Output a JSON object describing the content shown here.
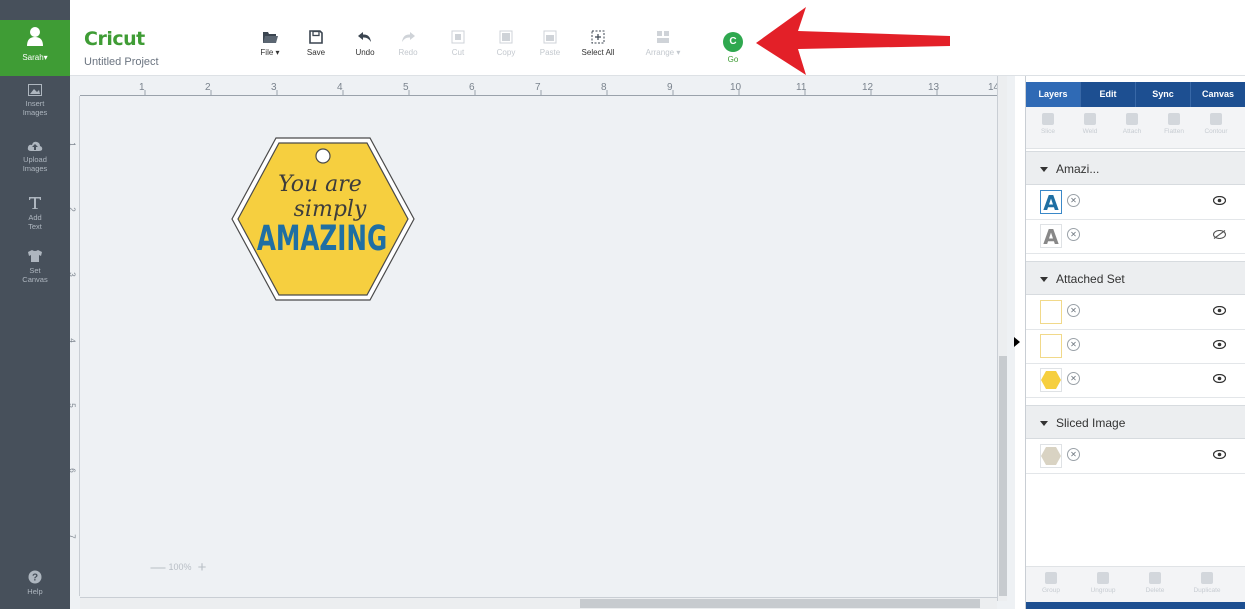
{
  "user": {
    "name": "Sarah▾"
  },
  "brand": {
    "name": "Cricut",
    "project": "Untitled Project"
  },
  "nav": {
    "insert_images": [
      "Insert",
      "Images"
    ],
    "upload_images": [
      "Upload",
      "Images"
    ],
    "add_text": [
      "Add",
      "Text"
    ],
    "set_canvas": [
      "Set",
      "Canvas"
    ],
    "help": "Help"
  },
  "toolbar": {
    "file": "File ▾",
    "save": "Save",
    "undo": "Undo",
    "redo": "Redo",
    "cut": "Cut",
    "copy": "Copy",
    "paste": "Paste",
    "select_all": "Select All",
    "arrange": "Arrange ▾",
    "go": "Go",
    "go_glyph": "C"
  },
  "ruler": {
    "h_labels": [
      "1",
      "2",
      "3",
      "4",
      "5",
      "6",
      "7",
      "8",
      "9",
      "10",
      "11",
      "12",
      "13",
      "14"
    ],
    "v_labels": [
      "1",
      "2",
      "3",
      "4",
      "5",
      "6",
      "7"
    ]
  },
  "zoom": {
    "minus": "—",
    "value": "100%",
    "plus": "+"
  },
  "design": {
    "line1": "You are",
    "line2": "simply",
    "line3": "AMAZING"
  },
  "panel": {
    "tabs": [
      "Layers",
      "Edit",
      "Sync",
      "Canvas"
    ],
    "tools": [
      "Slice",
      "Weld",
      "Attach",
      "Flatten",
      "Contour"
    ],
    "groups": [
      {
        "name": "Amazi...",
        "layers": [
          {
            "thumb": "A",
            "visible": true
          },
          {
            "thumb": "A",
            "visible": false
          }
        ]
      },
      {
        "name": "Attached Set",
        "layers": [
          {
            "thumb": "",
            "visible": true
          },
          {
            "thumb": "",
            "visible": true
          },
          {
            "thumb": "hexagon",
            "visible": true
          }
        ]
      },
      {
        "name": "Sliced Image",
        "layers": [
          {
            "thumb": "hexagon-gray",
            "visible": true
          }
        ]
      }
    ],
    "footer": [
      "Group",
      "Ungroup",
      "Delete",
      "Duplicate"
    ]
  },
  "colors": {
    "brand_green": "#3f9c35",
    "nav_bg": "#47505b",
    "panel_blue": "#1d4f91",
    "tag_yellow": "#f6cf3f",
    "text_blue": "#1f6fa3",
    "arrow_red": "#e32028"
  }
}
